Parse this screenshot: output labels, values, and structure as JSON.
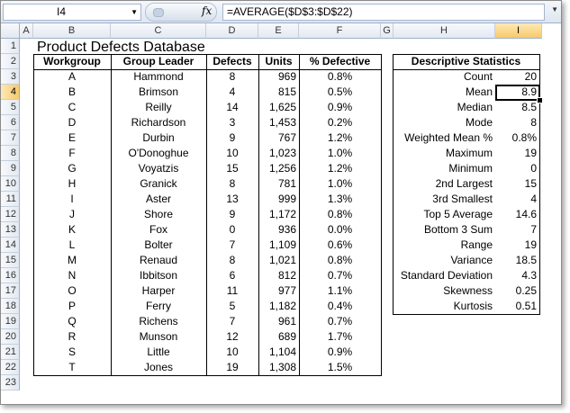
{
  "formula_bar": {
    "name_box": "I4",
    "fx_label": "fx",
    "formula": "=AVERAGE($D$3:$D$22)"
  },
  "columns": [
    "A",
    "B",
    "C",
    "D",
    "E",
    "F",
    "G",
    "H",
    "I"
  ],
  "rows": [
    "1",
    "2",
    "3",
    "4",
    "5",
    "6",
    "7",
    "8",
    "9",
    "10",
    "11",
    "12",
    "13",
    "14",
    "15",
    "16",
    "17",
    "18",
    "19",
    "20",
    "21",
    "22",
    "23"
  ],
  "title": "Product Defects Database",
  "table": {
    "headers": [
      "Workgroup",
      "Group Leader",
      "Defects",
      "Units",
      "% Defective"
    ],
    "rows": [
      [
        "A",
        "Hammond",
        "8",
        "969",
        "0.8%"
      ],
      [
        "B",
        "Brimson",
        "4",
        "815",
        "0.5%"
      ],
      [
        "C",
        "Reilly",
        "14",
        "1,625",
        "0.9%"
      ],
      [
        "D",
        "Richardson",
        "3",
        "1,453",
        "0.2%"
      ],
      [
        "E",
        "Durbin",
        "9",
        "767",
        "1.2%"
      ],
      [
        "F",
        "O'Donoghue",
        "10",
        "1,023",
        "1.0%"
      ],
      [
        "G",
        "Voyatzis",
        "15",
        "1,256",
        "1.2%"
      ],
      [
        "H",
        "Granick",
        "8",
        "781",
        "1.0%"
      ],
      [
        "I",
        "Aster",
        "13",
        "999",
        "1.3%"
      ],
      [
        "J",
        "Shore",
        "9",
        "1,172",
        "0.8%"
      ],
      [
        "K",
        "Fox",
        "0",
        "936",
        "0.0%"
      ],
      [
        "L",
        "Bolter",
        "7",
        "1,109",
        "0.6%"
      ],
      [
        "M",
        "Renaud",
        "8",
        "1,021",
        "0.8%"
      ],
      [
        "N",
        "Ibbitson",
        "6",
        "812",
        "0.7%"
      ],
      [
        "O",
        "Harper",
        "11",
        "977",
        "1.1%"
      ],
      [
        "P",
        "Ferry",
        "5",
        "1,182",
        "0.4%"
      ],
      [
        "Q",
        "Richens",
        "7",
        "961",
        "0.7%"
      ],
      [
        "R",
        "Munson",
        "12",
        "689",
        "1.7%"
      ],
      [
        "S",
        "Little",
        "10",
        "1,104",
        "0.9%"
      ],
      [
        "T",
        "Jones",
        "19",
        "1,308",
        "1.5%"
      ]
    ]
  },
  "stats": {
    "header": "Descriptive Statistics",
    "rows": [
      [
        "Count",
        "20"
      ],
      [
        "Mean",
        "8.9"
      ],
      [
        "Median",
        "8.5"
      ],
      [
        "Mode",
        "8"
      ],
      [
        "Weighted Mean %",
        "0.8%"
      ],
      [
        "Maximum",
        "19"
      ],
      [
        "Minimum",
        "0"
      ],
      [
        "2nd Largest",
        "15"
      ],
      [
        "3rd Smallest",
        "4"
      ],
      [
        "Top 5 Average",
        "14.6"
      ],
      [
        "Bottom 3 Sum",
        "7"
      ],
      [
        "Range",
        "19"
      ],
      [
        "Variance",
        "18.5"
      ],
      [
        "Standard Deviation",
        "4.3"
      ],
      [
        "Skewness",
        "0.25"
      ],
      [
        "Kurtosis",
        "0.51"
      ]
    ]
  },
  "selection": {
    "column": "I",
    "row": "4"
  }
}
